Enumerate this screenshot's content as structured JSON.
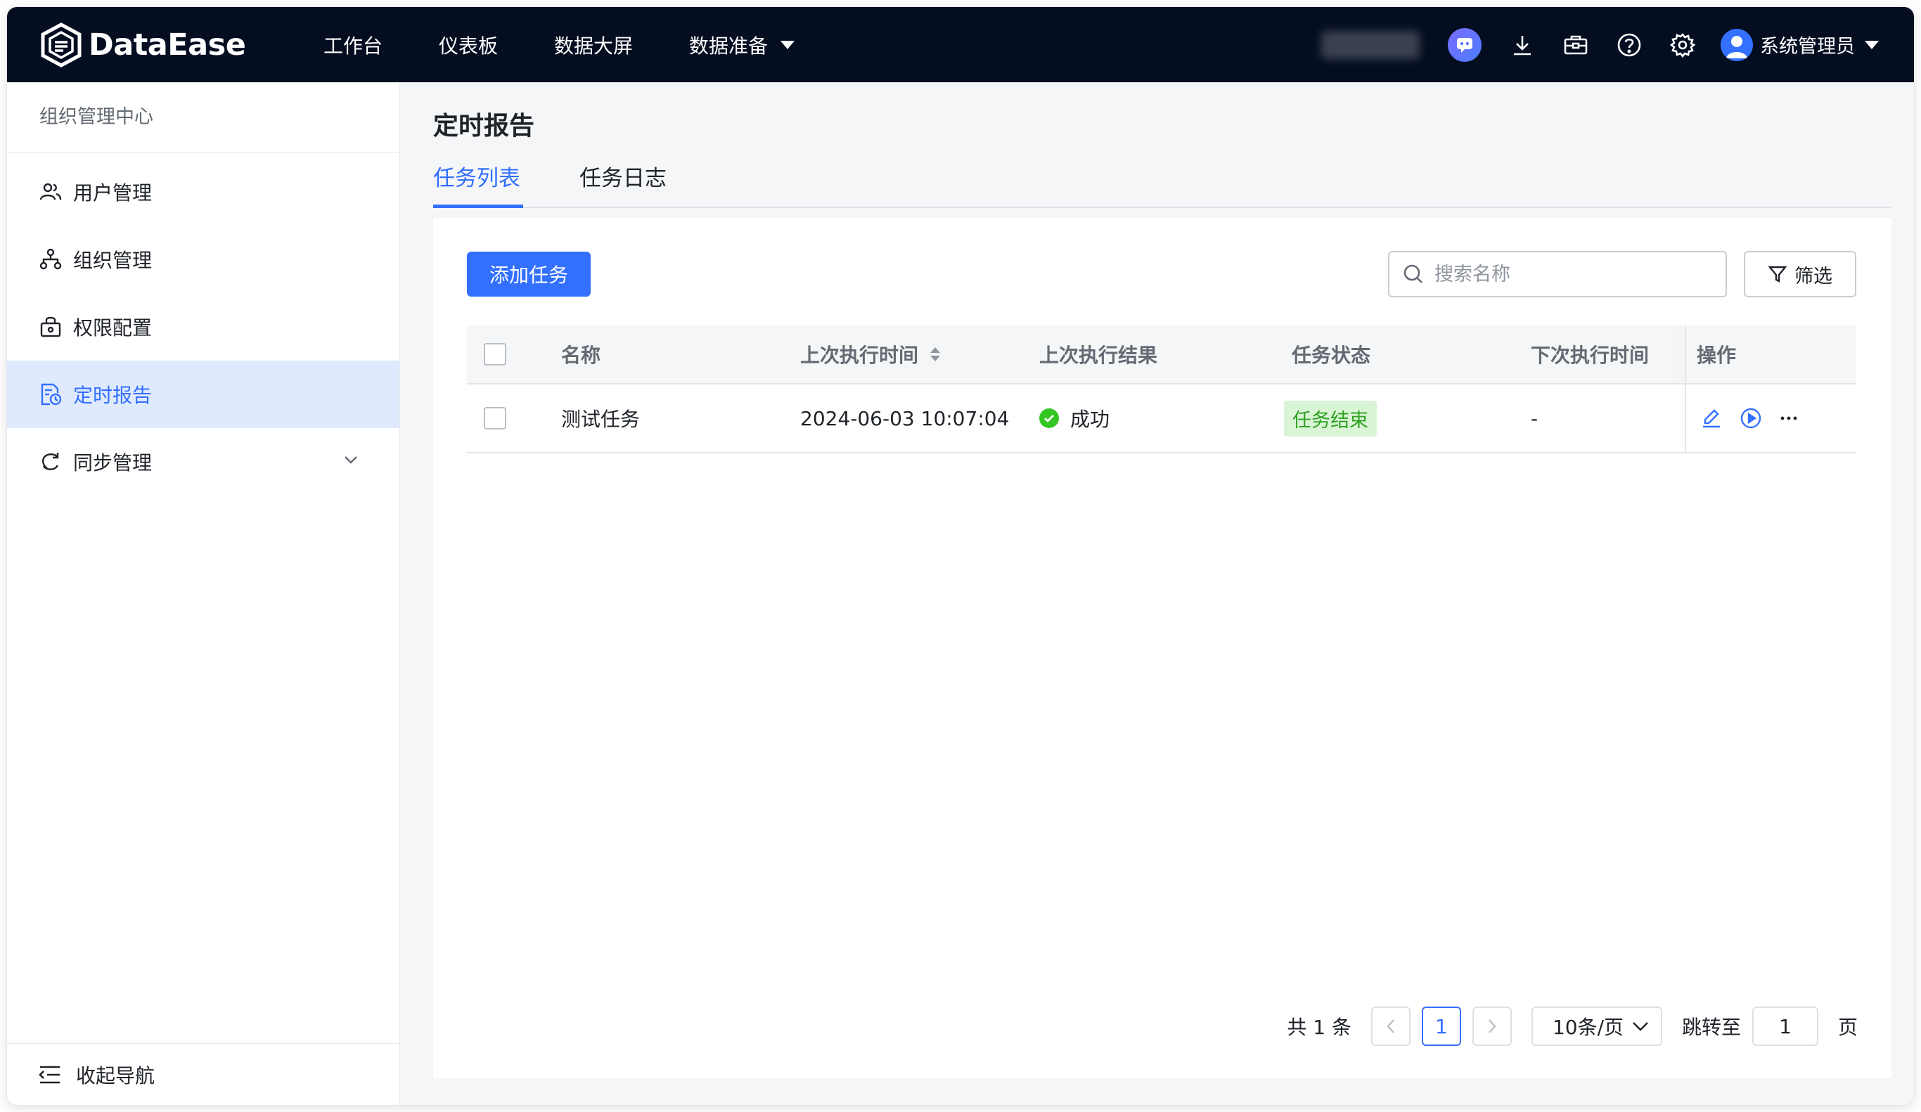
{
  "app": {
    "name": "DataEase"
  },
  "topnav": {
    "items": [
      {
        "label": "工作台"
      },
      {
        "label": "仪表板"
      },
      {
        "label": "数据大屏"
      },
      {
        "label": "数据准备",
        "has_dropdown": true
      }
    ],
    "icons": [
      "ai-assistant-icon",
      "download-icon",
      "toolbox-icon",
      "help-icon",
      "settings-icon"
    ],
    "user_name": "系统管理员"
  },
  "sidebar": {
    "title": "组织管理中心",
    "items": [
      {
        "label": "用户管理",
        "icon": "users-icon"
      },
      {
        "label": "组织管理",
        "icon": "org-tree-icon"
      },
      {
        "label": "权限配置",
        "icon": "lock-icon"
      },
      {
        "label": "定时报告",
        "icon": "report-clock-icon",
        "active": true
      },
      {
        "label": "同步管理",
        "icon": "sync-icon",
        "expandable": true
      }
    ],
    "collapse_label": "收起导航"
  },
  "page": {
    "title": "定时报告",
    "tabs": [
      {
        "label": "任务列表",
        "active": true
      },
      {
        "label": "任务日志"
      }
    ]
  },
  "toolbar": {
    "add_label": "添加任务",
    "search_placeholder": "搜索名称",
    "filter_label": "筛选"
  },
  "table": {
    "columns": [
      "名称",
      "上次执行时间",
      "上次执行结果",
      "任务状态",
      "下次执行时间",
      "操作"
    ],
    "rows": [
      {
        "name": "测试任务",
        "last_run_time": "2024-06-03 10:07:04",
        "last_result": "成功",
        "status": "任务结束",
        "next_run_time": "-"
      }
    ]
  },
  "pagination": {
    "total_label": "共 1 条",
    "current_page": "1",
    "page_size": "10条/页",
    "jump_label": "跳转至",
    "jump_value": "1",
    "page_unit": "页"
  },
  "colors": {
    "topbar_bg": "#050e21",
    "primary": "#3370ff",
    "success": "#34c724",
    "success_tag_bg": "#d9f5d6",
    "active_side_bg": "#e0eaff"
  }
}
